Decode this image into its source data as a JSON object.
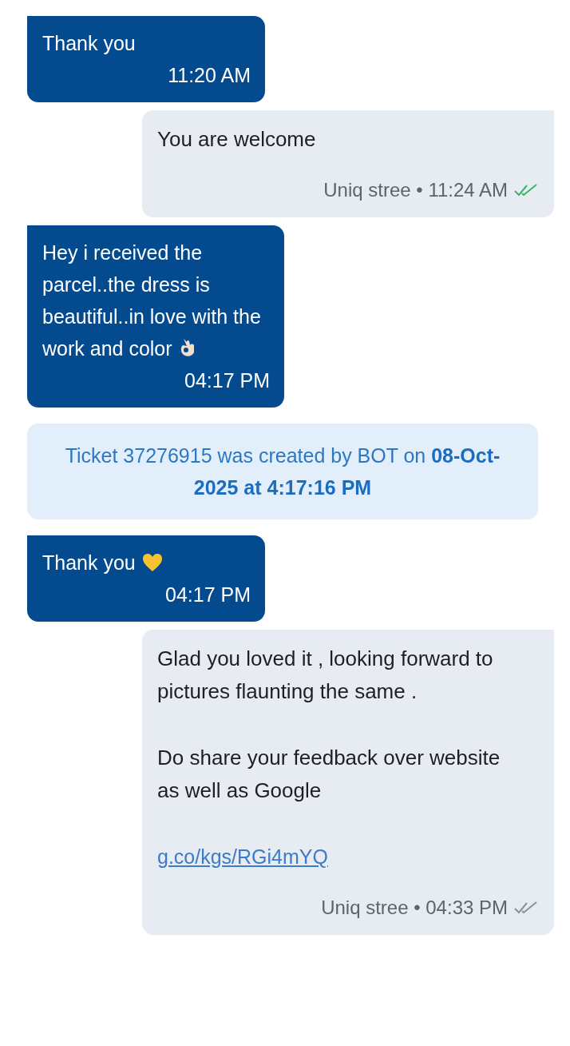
{
  "messages": [
    {
      "kind": "incoming",
      "text": "Thank you",
      "time": "11:20 AM"
    },
    {
      "kind": "outgoing",
      "paragraphs": [
        "You are welcome"
      ],
      "sender": "Uniq stree",
      "separator": "•",
      "time": "11:24 AM",
      "read": true
    },
    {
      "kind": "incoming",
      "text": "Hey i received the parcel..the dress is beautiful..in love with the work and color",
      "emoji": {
        "kind": "ok-hand"
      },
      "time": "04:17 PM"
    },
    {
      "kind": "system",
      "text": "Ticket 37276915 was created by BOT on **08-Oct-2025 at 4:17:16 PM**"
    },
    {
      "kind": "incoming",
      "text": "Thank you",
      "emoji": {
        "kind": "yellow-heart"
      },
      "time": "04:17 PM"
    },
    {
      "kind": "outgoing",
      "paragraphs": [
        "Glad you loved it , looking forward to pictures flaunting the same .",
        "Do share your feedback over website as well as Google"
      ],
      "link": "g.co/kgs/RGi4mYQ",
      "sender": "Uniq stree",
      "separator": "•",
      "time": "04:33 PM",
      "read": false
    }
  ]
}
